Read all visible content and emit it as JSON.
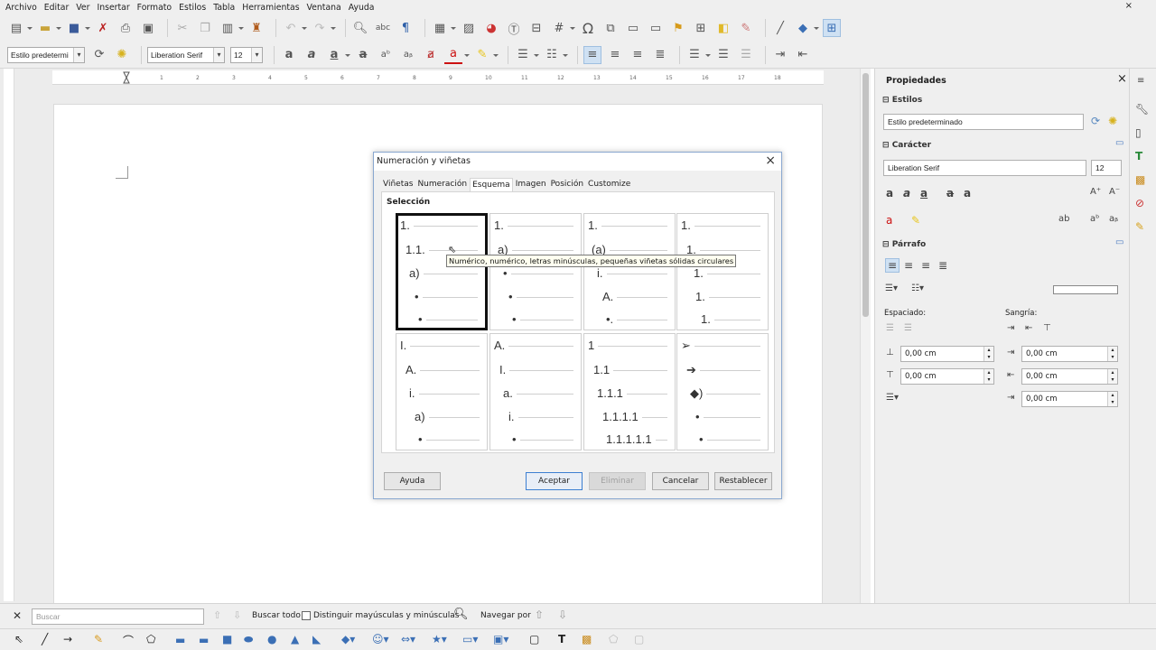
{
  "menubar": [
    "Archivo",
    "Editar",
    "Ver",
    "Insertar",
    "Formato",
    "Estilos",
    "Tabla",
    "Herramientas",
    "Ventana",
    "Ayuda"
  ],
  "menubar_close": "×",
  "formatbar": {
    "para_style": "Estilo predetermi",
    "font_name": "Liberation Serif",
    "font_size": "12"
  },
  "dialog": {
    "title": "Numeración y viñetas",
    "close": "×",
    "tabs": [
      "Viñetas",
      "Numeración",
      "Esquema",
      "Imagen",
      "Posición",
      "Customize"
    ],
    "selected_tab": "Esquema",
    "section_label": "Selección",
    "tooltip": "Numérico, numérico, letras minúsculas, pequeñas viñetas sólidas circulares",
    "cells": [
      {
        "lines": [
          {
            "t": "1.",
            "x": 4
          },
          {
            "t": "1.1.",
            "x": 10
          },
          {
            "t": "a)",
            "x": 14
          },
          {
            "t": "•",
            "x": 20
          },
          {
            "t": "•",
            "x": 24
          }
        ]
      },
      {
        "lines": [
          {
            "t": "1.",
            "x": 4
          },
          {
            "t": "a)",
            "x": 8
          },
          {
            "t": "•",
            "x": 14
          },
          {
            "t": "•",
            "x": 20
          },
          {
            "t": "•",
            "x": 24
          }
        ]
      },
      {
        "lines": [
          {
            "t": "1.",
            "x": 4
          },
          {
            "t": "(a)",
            "x": 8
          },
          {
            "t": "i.",
            "x": 14
          },
          {
            "t": "A.",
            "x": 20
          },
          {
            "t": "•.",
            "x": 24
          }
        ]
      },
      {
        "lines": [
          {
            "t": "1.",
            "x": 4
          },
          {
            "t": "1.",
            "x": 10
          },
          {
            "t": "1.",
            "x": 18
          },
          {
            "t": "1.",
            "x": 20
          },
          {
            "t": "1.",
            "x": 26
          }
        ]
      },
      {
        "lines": [
          {
            "t": "I.",
            "x": 4
          },
          {
            "t": "A.",
            "x": 10
          },
          {
            "t": "i.",
            "x": 14
          },
          {
            "t": "a)",
            "x": 20
          },
          {
            "t": "•",
            "x": 24
          }
        ]
      },
      {
        "lines": [
          {
            "t": "A.",
            "x": 4
          },
          {
            "t": "I.",
            "x": 10
          },
          {
            "t": "a.",
            "x": 14
          },
          {
            "t": "i.",
            "x": 20
          },
          {
            "t": "•",
            "x": 24
          }
        ]
      },
      {
        "lines": [
          {
            "t": "1",
            "x": 4
          },
          {
            "t": "1.1",
            "x": 10
          },
          {
            "t": "1.1.1",
            "x": 14
          },
          {
            "t": "1.1.1.1",
            "x": 20
          },
          {
            "t": "1.1.1.1.1",
            "x": 24
          }
        ]
      },
      {
        "lines": [
          {
            "t": "➢",
            "x": 4
          },
          {
            "t": "➔",
            "x": 10
          },
          {
            "t": "◆)",
            "x": 14
          },
          {
            "t": "•",
            "x": 20
          },
          {
            "t": "•",
            "x": 24
          }
        ]
      }
    ],
    "buttons": {
      "help": "Ayuda",
      "ok": "Aceptar",
      "delete": "Eliminar",
      "cancel": "Cancelar",
      "reset": "Restablecer"
    }
  },
  "sidebar": {
    "title": "Propiedades",
    "close": "×",
    "styles_header": "Estilos",
    "style_value": "Estilo predeterminado",
    "char_header": "Carácter",
    "font_name": "Liberation Serif",
    "font_size": "12",
    "para_header": "Párrafo",
    "spacing_label": "Espaciado:",
    "indent_label": "Sangría:",
    "spacing_above": "0,00 cm",
    "spacing_below": "0,00 cm",
    "indent_before": "0,00 cm",
    "indent_after": "0,00 cm",
    "indent_first": "0,00 cm"
  },
  "findbar": {
    "close": "✕",
    "search_placeholder": "Buscar",
    "find_all": "Buscar todo",
    "match_case": "Distinguir mayúsculas y minúsculas",
    "navigate_by": "Navegar por"
  },
  "ruler_marks": [
    "1",
    "2",
    "3",
    "4",
    "5",
    "6",
    "7",
    "8",
    "9",
    "10",
    "11",
    "12",
    "13",
    "14",
    "15",
    "16",
    "17",
    "18"
  ],
  "colors": {
    "accent": "#3c7fd1",
    "chrome": "#efefef"
  }
}
